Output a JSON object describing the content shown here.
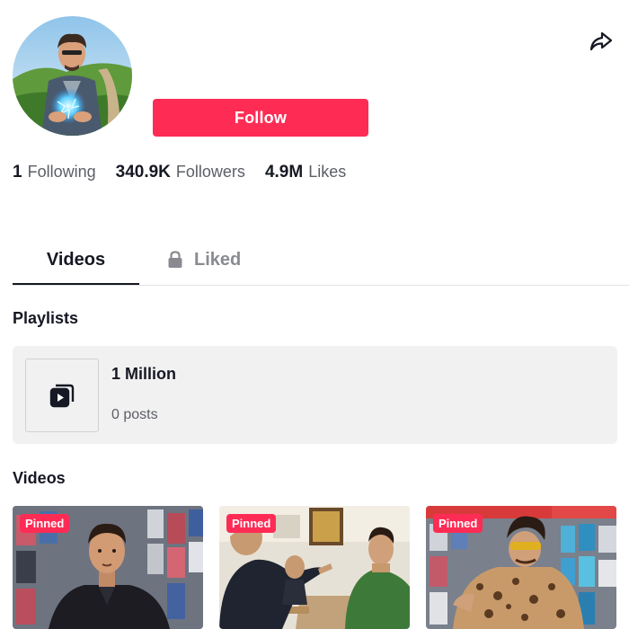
{
  "profile": {
    "follow_label": "Follow",
    "stats": [
      {
        "value": "1",
        "label": "Following"
      },
      {
        "value": "340.9K",
        "label": "Followers"
      },
      {
        "value": "4.9M",
        "label": "Likes"
      }
    ],
    "share_icon": "share-arrow-icon"
  },
  "tabs": {
    "videos": "Videos",
    "liked": "Liked",
    "liked_icon": "lock-icon"
  },
  "playlists": {
    "heading": "Playlists",
    "items": [
      {
        "title": "1 Million",
        "count": "0 posts"
      }
    ]
  },
  "videos": {
    "heading": "Videos",
    "items": [
      {
        "badge": "Pinned"
      },
      {
        "badge": "Pinned"
      },
      {
        "badge": "Pinned"
      }
    ]
  },
  "colors": {
    "accent": "#fe2c55",
    "text": "#161823",
    "muted": "#5c5e66",
    "card_bg": "#f1f1f2"
  }
}
